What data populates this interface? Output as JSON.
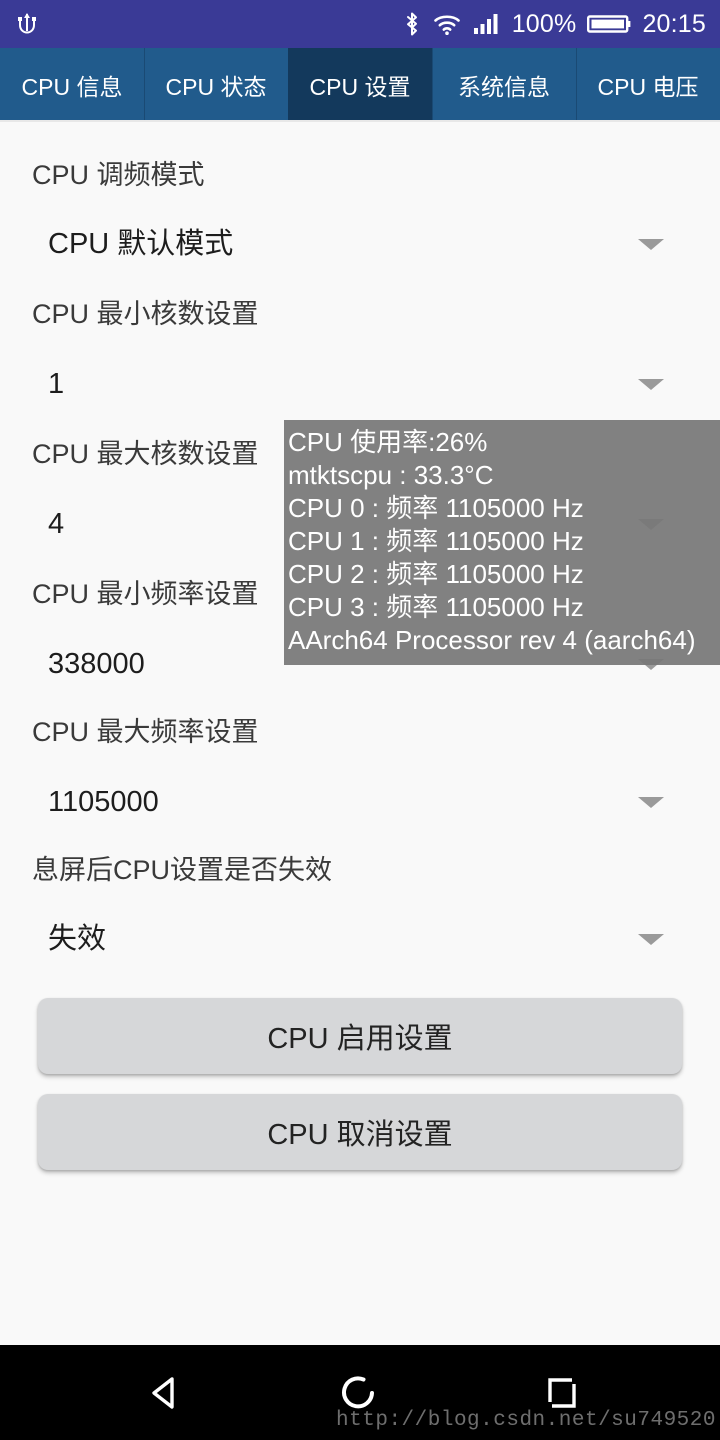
{
  "status_bar": {
    "usb_icon": "usb-debug-icon",
    "bluetooth_icon": "bluetooth-icon",
    "wifi_icon": "wifi-icon",
    "signal_icon": "cellular-signal-icon",
    "battery_percent": "100%",
    "battery_icon": "battery-full-icon",
    "clock": "20:15",
    "background_color": "#3a3a96"
  },
  "tabs": {
    "selected_index": 2,
    "items": [
      {
        "label": "CPU 信息"
      },
      {
        "label": "CPU 状态"
      },
      {
        "label": "CPU 设置"
      },
      {
        "label": "系统信息"
      },
      {
        "label": "CPU 电压"
      }
    ],
    "background_color": "#215b8c",
    "selected_color": "#13395c"
  },
  "settings": {
    "fields": [
      {
        "label": "CPU 调频模式",
        "value": "CPU 默认模式",
        "caret": "chevron-down-icon"
      },
      {
        "label": "CPU 最小核数设置",
        "value": "1",
        "caret": "chevron-down-icon"
      },
      {
        "label": "CPU 最大核数设置",
        "value": "4",
        "caret": "chevron-down-icon"
      },
      {
        "label": "CPU 最小频率设置",
        "value": "338000",
        "caret": "chevron-down-icon"
      },
      {
        "label": "CPU 最大频率设置",
        "value": "1105000",
        "caret": "chevron-down-icon"
      },
      {
        "label": "息屏后CPU设置是否失效",
        "value": "失效",
        "caret": "chevron-down-icon"
      }
    ],
    "buttons": {
      "enable": "CPU 启用设置",
      "cancel": "CPU 取消设置"
    }
  },
  "toast": {
    "background_color": "#777777",
    "lines": [
      "CPU 使用率:26%",
      "mtktscpu : 33.3°C",
      "CPU 0 : 频率 1105000 Hz",
      "CPU 1 : 频率 1105000 Hz",
      "CPU 2 : 频率 1105000 Hz",
      "CPU 3 : 频率 1105000 Hz",
      "AArch64 Processor rev 4 (aarch64)"
    ]
  },
  "nav_bar": {
    "back_icon": "back-triangle-icon",
    "home_icon": "home-circle-icon",
    "recent_icon": "recents-square-icon",
    "watermark": "http://blog.csdn.net/su749520"
  }
}
